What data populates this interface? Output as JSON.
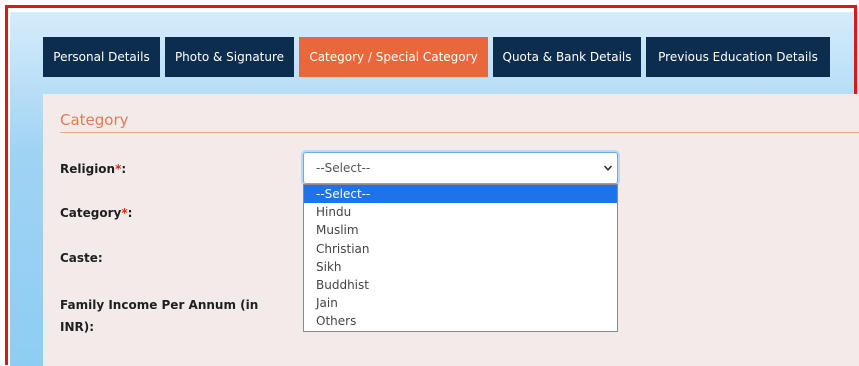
{
  "tabs": [
    {
      "label": "Personal Details",
      "active": false
    },
    {
      "label": "Photo & Signature",
      "active": false
    },
    {
      "label": "Category / Special Category",
      "active": true
    },
    {
      "label": "Quota & Bank Details",
      "active": false
    },
    {
      "label": "Previous Education Details",
      "active": false
    }
  ],
  "section": {
    "title": "Category"
  },
  "form": {
    "religion_label": "Religion",
    "category_label": "Category",
    "required_mark": "*",
    "colon": ":",
    "caste_label": "Caste:",
    "income_label": "Family Income Per Annum (in INR):"
  },
  "religion_select": {
    "value": "--Select--",
    "icon": "chevron-down-icon",
    "options": [
      "--Select--",
      "Hindu",
      "Muslim",
      "Christian",
      "Sikh",
      "Buddhist",
      "Jain",
      "Others"
    ],
    "highlighted": "--Select--"
  },
  "colors": {
    "tab_bg": "#0d2d4f",
    "tab_active_bg": "#e8673b",
    "section_title": "#e07b56",
    "required": "#d9261c",
    "option_highlight": "#1e73e8",
    "frame": "#d7191c"
  }
}
